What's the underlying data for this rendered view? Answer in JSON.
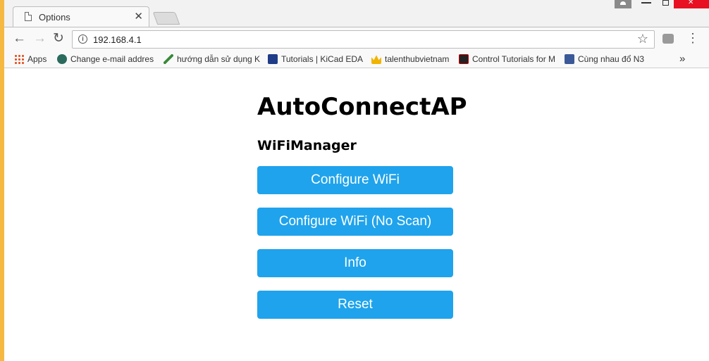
{
  "browser": {
    "tab_title": "Options",
    "tab_close": "✕",
    "url": "192.168.4.1",
    "nav": {
      "back": "←",
      "forward": "→",
      "reload": "↻"
    },
    "star": "☆",
    "menu": "⋮"
  },
  "bookmarks": [
    {
      "label": "Apps",
      "icon": "apps-grid-icon"
    },
    {
      "label": "Change e-mail addres",
      "icon": "site-icon"
    },
    {
      "label": "hướng dẫn sử dụng K",
      "icon": "leaf-icon"
    },
    {
      "label": "Tutorials | KiCad EDA",
      "icon": "kicad-icon"
    },
    {
      "label": "talenthubvietnam",
      "icon": "crown-icon"
    },
    {
      "label": "Control Tutorials for M",
      "icon": "control-icon"
    },
    {
      "label": "Cùng nhau đổ N3",
      "icon": "facebook-icon"
    }
  ],
  "bookmarks_more": "»",
  "page": {
    "title": "AutoConnectAP",
    "subtitle": "WiFiManager",
    "buttons": [
      {
        "label": "Configure WiFi"
      },
      {
        "label": "Configure WiFi (No Scan)"
      },
      {
        "label": "Info"
      },
      {
        "label": "Reset"
      }
    ]
  },
  "colors": {
    "button_bg": "#1fa3ec",
    "close_button": "#e81123"
  }
}
